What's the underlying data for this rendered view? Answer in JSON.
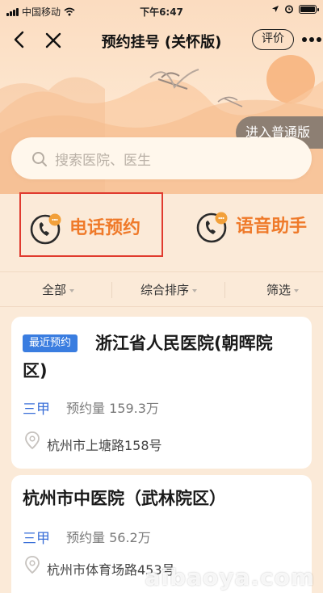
{
  "status_bar": {
    "carrier": "中国移动",
    "time": "下午6:47"
  },
  "nav": {
    "title": "预约挂号 (关怀版)",
    "evaluate_label": "评价"
  },
  "banner": {
    "switch_normal_label": "进入普通版"
  },
  "search": {
    "placeholder": "搜索医院、医生"
  },
  "services": [
    {
      "label": "电话预约",
      "icon": "phone-chat-icon"
    },
    {
      "label": "语音助手",
      "icon": "phone-chat-icon"
    }
  ],
  "filters": [
    {
      "label": "全部"
    },
    {
      "label": "综合排序"
    },
    {
      "label": "筛选"
    }
  ],
  "hospitals": [
    {
      "tag": "最近预约",
      "name_line1": "浙江省人民医院(朝晖院",
      "name_line2": "区)",
      "level": "三甲",
      "volume": "预约量 159.3万",
      "address": "杭州市上塘路158号"
    },
    {
      "name_line1": "杭州市中医院（武林院区）",
      "level": "三甲",
      "volume": "预约量 56.2万",
      "address": "杭州市体育场路453号"
    }
  ],
  "watermark": "aibaoya.com",
  "colors": {
    "accent_orange": "#ef7a2a",
    "tag_blue": "#3a7de0",
    "highlight_red": "#e03a2e",
    "page_bg": "#fbead8"
  }
}
